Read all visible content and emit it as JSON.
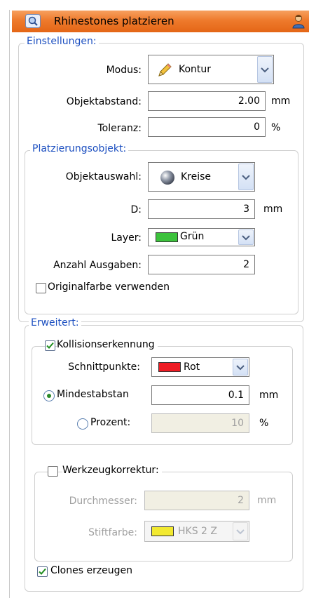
{
  "window": {
    "title": "Rhinestones platzieren",
    "app_icon": "magnifier-icon",
    "user_icon": "user-icon"
  },
  "einstellungen": {
    "legend": "Einstellungen:",
    "modus": {
      "label": "Modus:",
      "value": "Kontur",
      "icon": "pencil-icon"
    },
    "objektabstand": {
      "label": "Objektabstand:",
      "value": "2.00",
      "unit": "mm"
    },
    "toleranz": {
      "label": "Toleranz:",
      "value": "0",
      "unit": "%"
    },
    "platzierungsobjekt": {
      "legend": "Platzierungsobjekt:",
      "objektauswahl": {
        "label": "Objektauswahl:",
        "value": "Kreise",
        "icon": "sphere-icon"
      },
      "d": {
        "label": "D:",
        "value": "3",
        "unit": "mm"
      },
      "layer": {
        "label": "Layer:",
        "value": "Grün",
        "color": "#3cc23c"
      },
      "anzahl": {
        "label": "Anzahl Ausgaben:",
        "value": "2"
      },
      "originalfarbe": {
        "label": "Originalfarbe verwenden",
        "checked": false
      }
    }
  },
  "erweitert": {
    "legend": "Erweitert:",
    "kollision": {
      "label": "Kollisionserkennung",
      "checked": true,
      "schnittpunkte": {
        "label": "Schnittpunkte:",
        "value": "Rot",
        "color": "#ee1c24"
      },
      "mindestabstand": {
        "label": "Mindestabstan",
        "value": "0.1",
        "unit": "mm",
        "selected": true
      },
      "prozent": {
        "label": "Prozent:",
        "value": "10",
        "unit": "%",
        "selected": false
      }
    },
    "werkzeug": {
      "label": "Werkzeugkorrektur:",
      "checked": false,
      "durchmesser": {
        "label": "Durchmesser:",
        "value": "2",
        "unit": "mm"
      },
      "stiftfarbe": {
        "label": "Stiftfarbe:",
        "value": "HKS 2 Z",
        "color": "#f2e930"
      }
    },
    "clones": {
      "label": "Clones erzeugen",
      "checked": true
    }
  }
}
